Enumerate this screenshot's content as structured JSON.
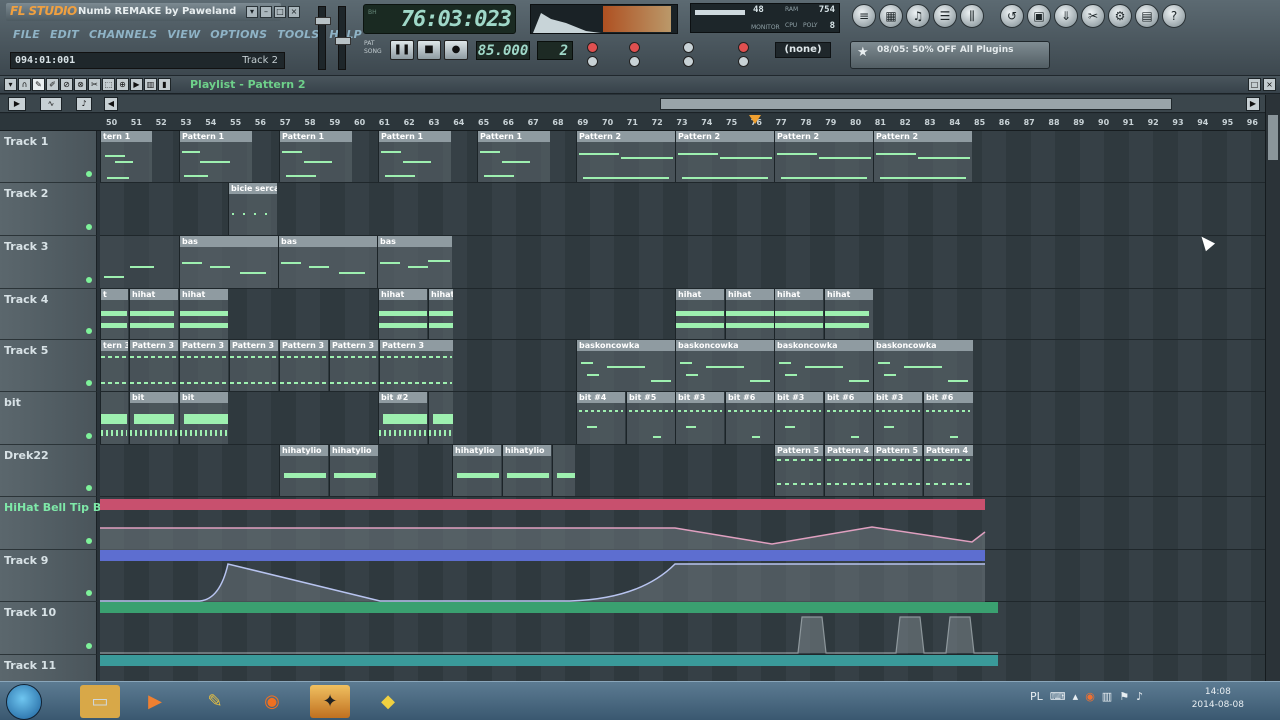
{
  "app": {
    "logo": "FL STUDIO",
    "song_title": "Numb REMAKE by Paweland"
  },
  "menu": [
    "FILE",
    "EDIT",
    "CHANNELS",
    "VIEW",
    "OPTIONS",
    "TOOLS",
    "HELP"
  ],
  "hint_bar": {
    "position": "094:01:001",
    "target": "Track 2"
  },
  "transport": {
    "time": "76:03:023",
    "time_tags": [
      "BH",
      "BN",
      "M:S:CS"
    ],
    "tempo": "85.000",
    "pattern": "2",
    "pattern_labels": [
      "PAT",
      "SONG"
    ]
  },
  "cpu": {
    "value_left": "48",
    "value_right": "754",
    "poly": "8",
    "labels": [
      "RAM",
      "CPU",
      "POLY",
      "MONITOR"
    ]
  },
  "pattern_picker": "(none)",
  "news": "08/05: 50% OFF All Plugins",
  "playlist": {
    "title": "Playlist - Pattern 2",
    "ruler_start": 50,
    "ruler_end": 96,
    "tracks": [
      {
        "name": "Track 1",
        "green": false
      },
      {
        "name": "Track 2",
        "green": false
      },
      {
        "name": "Track 3",
        "green": false
      },
      {
        "name": "Track 4",
        "green": false
      },
      {
        "name": "Track 5",
        "green": false
      },
      {
        "name": "bit",
        "green": false
      },
      {
        "name": "Drek22",
        "green": false
      },
      {
        "name": "HiHat Bell Tip B...",
        "green": true
      },
      {
        "name": "Track 9",
        "green": false
      },
      {
        "name": "Track 10",
        "green": false
      },
      {
        "name": "Track 11",
        "green": false
      }
    ],
    "clips": {
      "t1": [
        "tern 1",
        "Pattern 1",
        "Pattern 1",
        "Pattern 1",
        "Pattern 1",
        "Pattern 2",
        "Pattern 2",
        "Pattern 2",
        "Pattern 2"
      ],
      "t2": [
        "bicie serca"
      ],
      "t3": [
        "bas",
        "bas",
        "bas"
      ],
      "t4": [
        "t",
        "hihat",
        "hihat",
        "hihat",
        "hihat",
        "hihat",
        "hihat",
        "hihat",
        "hihat"
      ],
      "t5": [
        "tern 3",
        "Pattern 3",
        "Pattern 3",
        "Pattern 3",
        "Pattern 3",
        "Pattern 3",
        "Pattern 3",
        "baskoncowka",
        "baskoncowka",
        "baskoncowka",
        "baskoncowka"
      ],
      "t6": [
        "bit",
        "bit",
        "bit #2",
        "bit #4",
        "bit #5",
        "bit #3",
        "bit #6",
        "bit #3",
        "bit #6",
        "bit #3",
        "bit #6"
      ],
      "t7": [
        "hihatylio",
        "hihatylio",
        "hihatylio",
        "hihatylio",
        "Pattern 5",
        "Pattern 4",
        "Pattern 5",
        "Pattern 4"
      ]
    }
  },
  "taskbar": {
    "clock_time": "14:08",
    "clock_date": "2014-08-08",
    "lang": "PL"
  }
}
